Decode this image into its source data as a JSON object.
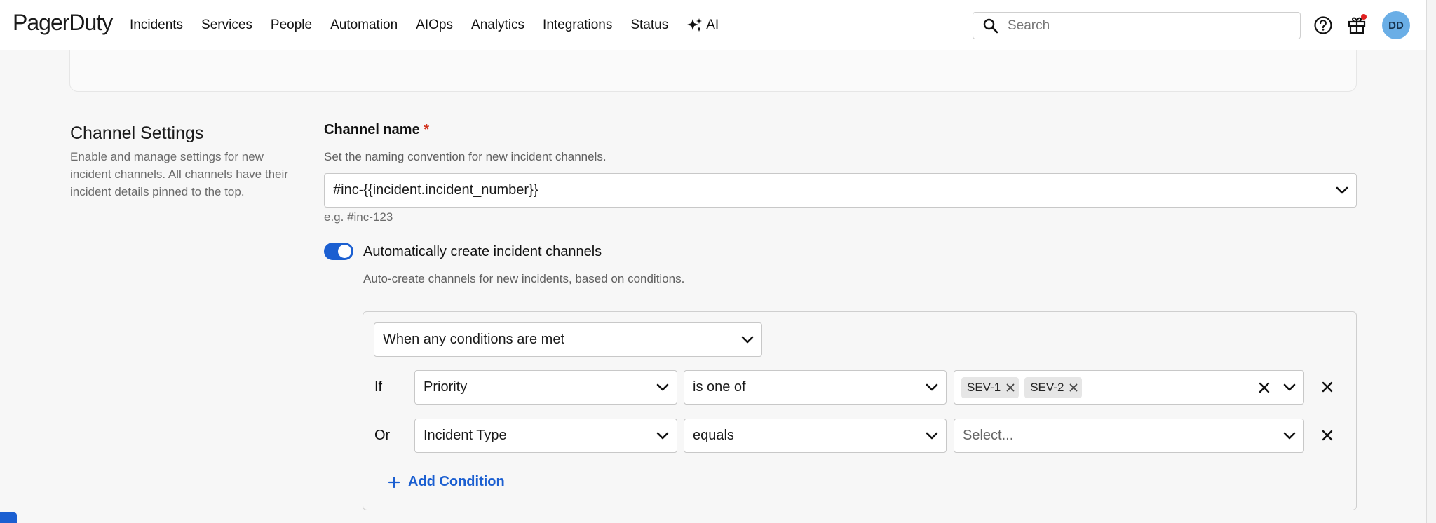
{
  "nav": {
    "logo": "PagerDuty",
    "items": [
      "Incidents",
      "Services",
      "People",
      "Automation",
      "AIOps",
      "Analytics",
      "Integrations",
      "Status"
    ],
    "ai_label": "AI",
    "search_placeholder": "Search",
    "avatar_initials": "DD"
  },
  "section": {
    "title": "Channel Settings",
    "description": "Enable and manage settings for new incident channels. All channels have their incident details pinned to the top."
  },
  "channel_name": {
    "label": "Channel name",
    "required_mark": "*",
    "help": "Set the naming convention for new incident channels.",
    "value": "#inc-{{incident.incident_number}}",
    "example": "e.g. #inc-123"
  },
  "auto_create": {
    "enabled": true,
    "label": "Automatically create incident channels",
    "help": "Auto-create channels for new incidents, based on conditions."
  },
  "conditions": {
    "match_mode": "When any conditions are met",
    "rows": [
      {
        "connector": "If",
        "field": "Priority",
        "operator": "is one of",
        "values": [
          "SEV-1",
          "SEV-2"
        ]
      },
      {
        "connector": "Or",
        "field": "Incident Type",
        "operator": "equals",
        "placeholder": "Select..."
      }
    ],
    "add_label": "Add Condition"
  },
  "colors": {
    "accent": "#1b5fd1",
    "required": "#d1331f",
    "avatar": "#6aaee6",
    "notification_dot": "#e02020"
  }
}
